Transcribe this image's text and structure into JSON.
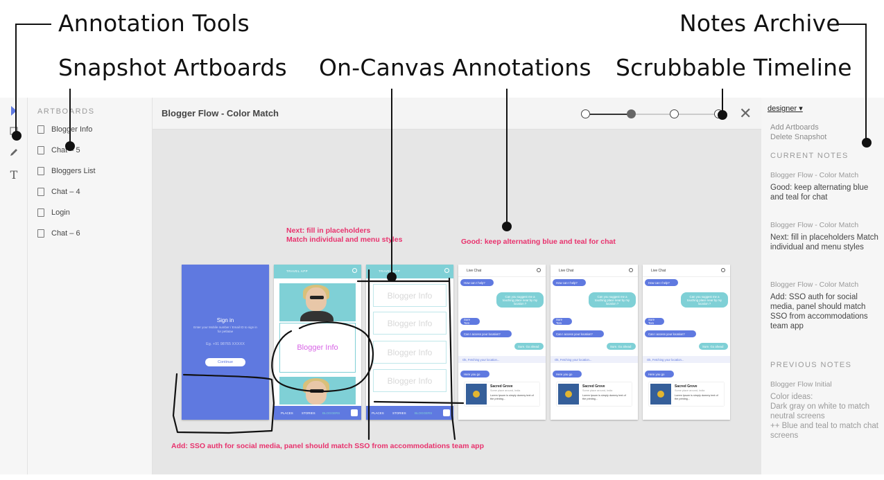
{
  "callouts": {
    "annotation_tools": "Annotation Tools",
    "notes_archive": "Notes Archive",
    "snapshot_artboards": "Snapshot Artboards",
    "on_canvas_annotations": "On-Canvas Annotations",
    "scrubbable_timeline": "Scrubbable Timeline"
  },
  "tools": [
    "pointer-icon",
    "rectangle-icon",
    "pencil-icon",
    "text-icon"
  ],
  "artboards": {
    "heading": "ARTBOARDS",
    "items": [
      "Blogger Info",
      "Chat – 5",
      "Bloggers List",
      "Chat – 4",
      "Login",
      "Chat – 6"
    ]
  },
  "main": {
    "title": "Blogger Flow - Color Match",
    "timeline_nodes": 4,
    "timeline_active_index": 1,
    "close_label": "✕"
  },
  "canvas_annotations": {
    "next": "Next: fill in placeholders\nMatch individual and menu styles",
    "good": "Good: keep alternating blue and teal for chat",
    "add": "Add: SSO auth for social media, panel should match SSO from accommodations team app"
  },
  "screens": {
    "signin": {
      "title": "Sign in",
      "subtitle": "Enter your Mobile number / Email ID to sign in for petlatae",
      "field": "Eg. +91 98765 XXXXX",
      "button": "Continue"
    },
    "travel": {
      "header": "TRAVEL APP",
      "card": "Blogger Info",
      "nav": [
        "PLACES",
        "STORIES",
        "BLOGGERS"
      ]
    },
    "list": {
      "header": "TRAVEL APP",
      "cards": [
        "Blogger Info",
        "Blogger Info",
        "Blogger Info",
        "Blogger Info"
      ],
      "nav": [
        "PLACES",
        "STORIES",
        "BLOGGERS"
      ]
    },
    "chat": {
      "header": "Live Chat",
      "messages": [
        {
          "side": "blue",
          "text": "How can I help?"
        },
        {
          "side": "teal",
          "text": "Can you suggest me a touching place near by my location ?"
        },
        {
          "side": "blue",
          "text": "Sure Tom"
        },
        {
          "side": "blue",
          "text": "Can I access your location?"
        },
        {
          "side": "teal",
          "text": "Sure. Go ahead"
        },
        {
          "side": "sys",
          "text": "Ok, Fetching your location..."
        },
        {
          "side": "blue",
          "text": "Here you go"
        }
      ],
      "place": {
        "title": "Sacred Grove",
        "subtitle": "Some place around, India",
        "desc": "Lorem Ipsum is simply dummy text of the printing..."
      }
    }
  },
  "notes": {
    "user": "designer ▾",
    "add_artboards": "Add Artboards",
    "delete_snapshot": "Delete Snapshot",
    "current_heading": "CURRENT NOTES",
    "current": [
      {
        "source": "Blogger Flow - Color Match",
        "text": "Good: keep alternating blue and teal for chat"
      },
      {
        "source": "Blogger Flow - Color Match",
        "text": "Next: fill in placeholders Match individual and menu styles"
      },
      {
        "source": "Blogger Flow - Color Match",
        "text": "Add: SSO auth for social media, panel should match SSO from accommodations team app"
      }
    ],
    "previous_heading": "PREVIOUS NOTES",
    "previous": [
      {
        "source": "Blogger Flow Initial",
        "text": "Color ideas:\nDark gray on white to match neutral screens\n++ Blue and teal to match chat screens"
      }
    ]
  },
  "colors": {
    "accent_blue": "#5f79e0",
    "accent_teal": "#7fd0d6",
    "annotation_pink": "#e8326d"
  }
}
